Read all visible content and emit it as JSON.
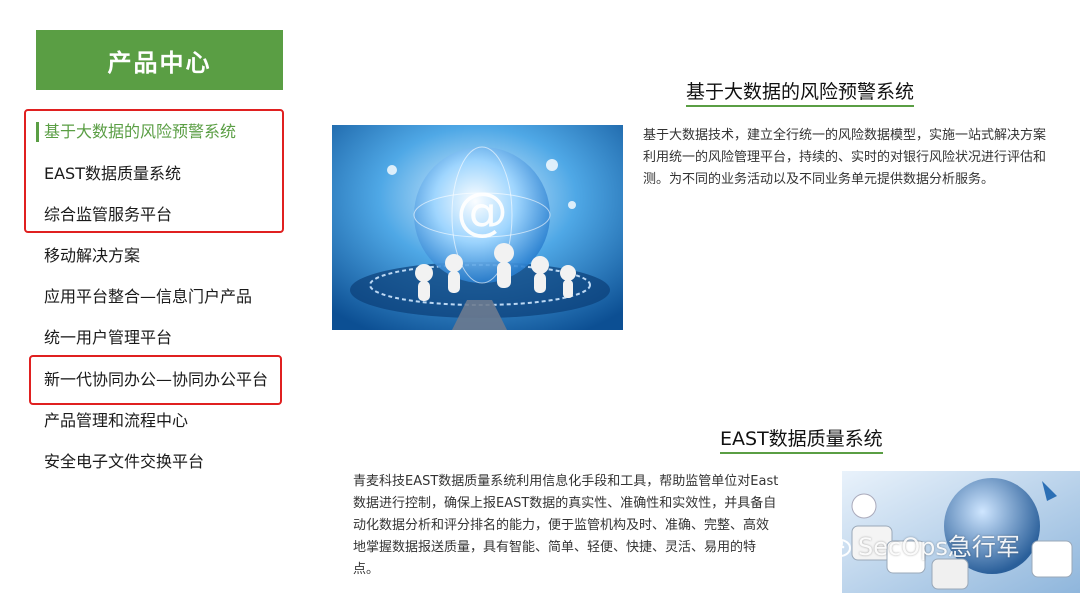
{
  "sidebar": {
    "title": "产品中心",
    "items": [
      {
        "label": "基于大数据的风险预警系统"
      },
      {
        "label": "EAST数据质量系统"
      },
      {
        "label": "综合监管服务平台"
      },
      {
        "label": "移动解决方案"
      },
      {
        "label": "应用平台整合—信息门户产品"
      },
      {
        "label": "统一用户管理平台"
      },
      {
        "label": "新一代协同办公—协同办公平台"
      },
      {
        "label": "产品管理和流程中心"
      },
      {
        "label": "安全电子文件交换平台"
      }
    ]
  },
  "sections": [
    {
      "title": "基于大数据的风险预警系统",
      "lines": [
        "基于大数据技术，建立全行统一的风险数据模型，实施一站式解决方案",
        "利用统一的风险管理平台，持续的、实时的对银行风险状况进行评估和",
        "测。为不同的业务活动以及不同业务单元提供数据分析服务。"
      ]
    },
    {
      "title": "EAST数据质量系统",
      "lines": [
        "青麦科技EAST数据质量系统利用信息化手段和工具，帮助监管单位对East",
        "数据进行控制，确保上报EAST数据的真实性、准确性和实效性，并具备自",
        "动化数据分析和评分排名的能力，便于监管机构及时、准确、完整、高效",
        "地掌握数据报送质量，具有智能、简单、轻便、快捷、灵活、易用的特",
        "点。"
      ]
    }
  ],
  "watermark": {
    "text": "SecOps急行军",
    "icon": "wechat-icon"
  },
  "colors": {
    "accent": "#5a9e44",
    "highlight": "#e02020"
  }
}
